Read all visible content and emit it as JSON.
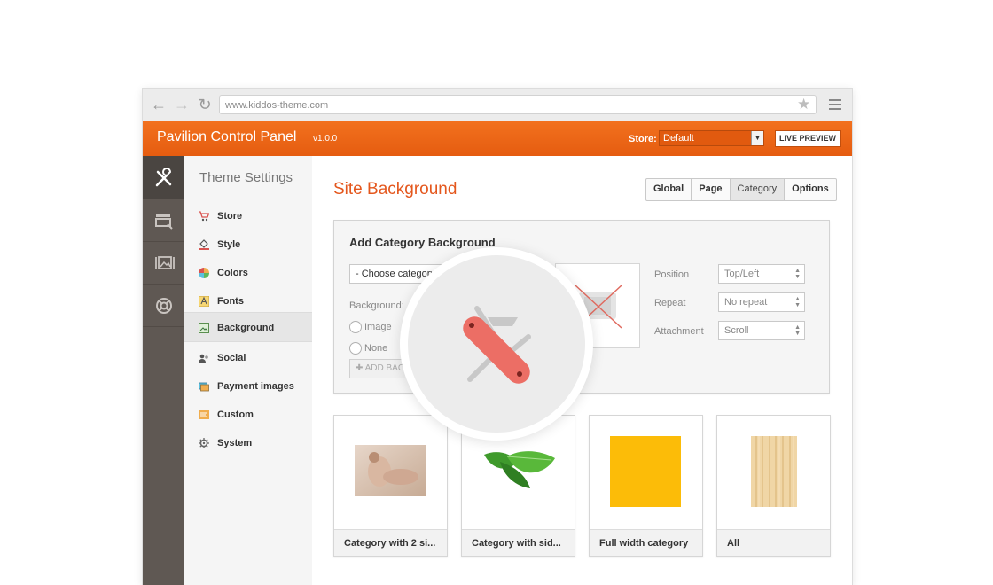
{
  "browser": {
    "url": "www.kiddos-theme.com"
  },
  "header": {
    "brand": "Pavilion Control Panel",
    "version": "v1.0.0",
    "store_label": "Store:",
    "store_value": "Default",
    "live_preview": "LIVE PREVIEW",
    "accent": "#e8621a"
  },
  "sidebar": {
    "title": "Theme Settings",
    "items": [
      {
        "label": "Store"
      },
      {
        "label": "Style"
      },
      {
        "label": "Colors"
      },
      {
        "label": "Fonts"
      },
      {
        "label": "Background"
      },
      {
        "label": "Social"
      },
      {
        "label": "Payment images"
      },
      {
        "label": "Custom"
      },
      {
        "label": "System"
      }
    ]
  },
  "main": {
    "title": "Site Background",
    "tabs": [
      {
        "label": "Global"
      },
      {
        "label": "Page"
      },
      {
        "label": "Category"
      },
      {
        "label": "Options"
      }
    ],
    "panel": {
      "title": "Add Category Background",
      "choose_category": "- Choose category -",
      "background_label": "Background:",
      "radio_image": "Image",
      "radio_none": "None",
      "add_button": "ADD BACK",
      "position_label": "Position",
      "position_value": "Top/Left",
      "repeat_label": "Repeat",
      "repeat_value": "No repeat",
      "attachment_label": "Attachment",
      "attachment_value": "Scroll"
    },
    "cards": [
      {
        "caption": "Category with 2 si..."
      },
      {
        "caption": "Category with sid..."
      },
      {
        "caption": "Full width category"
      },
      {
        "caption": "All"
      }
    ]
  }
}
